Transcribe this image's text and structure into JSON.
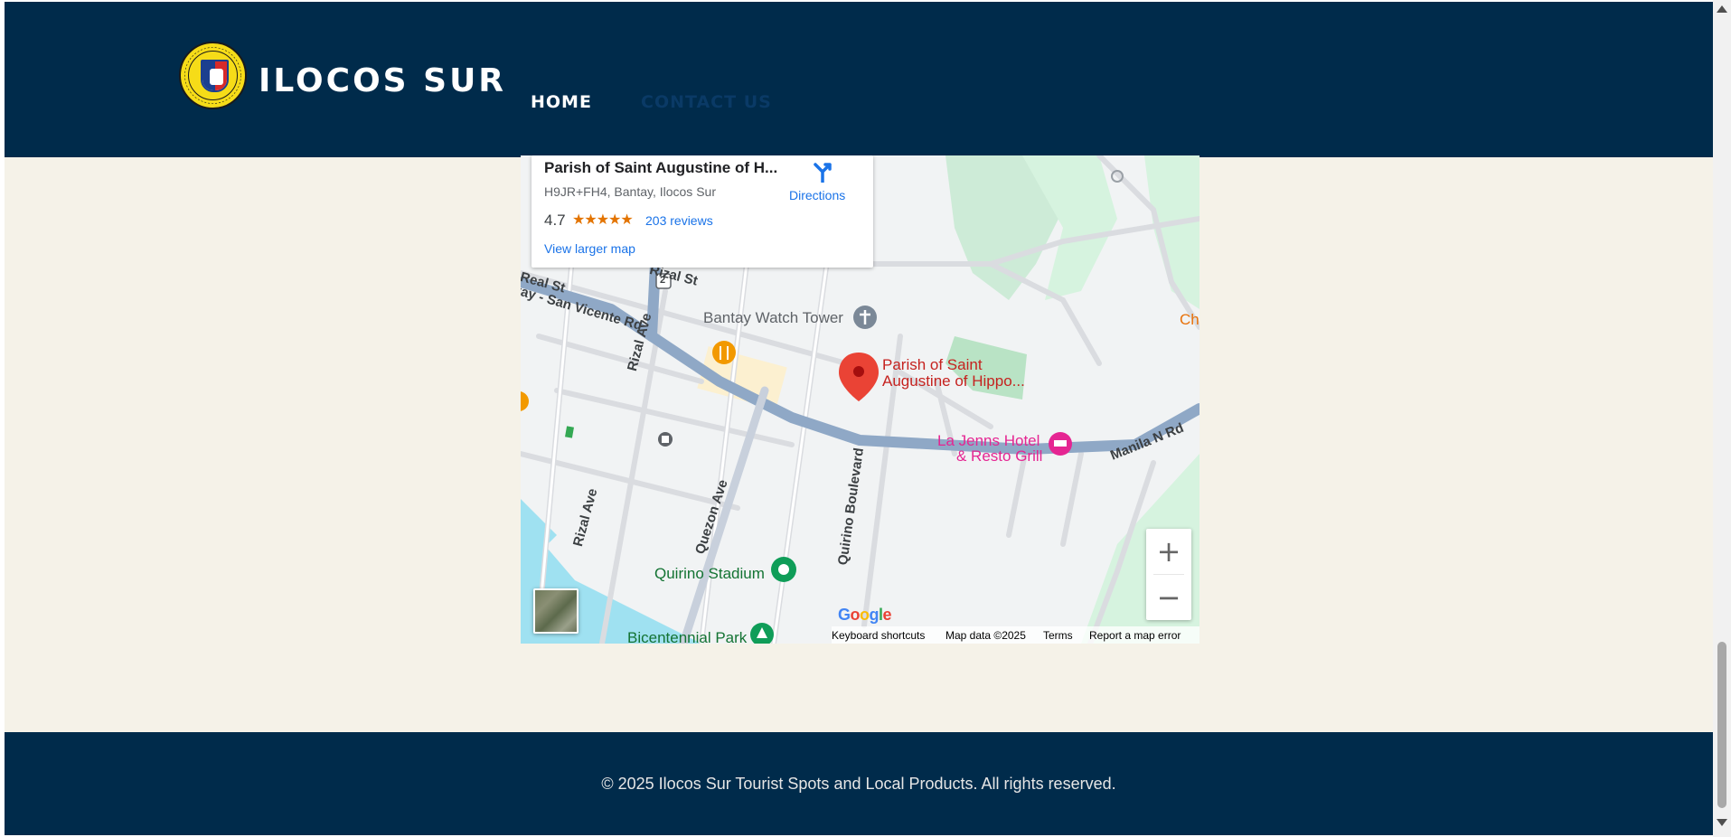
{
  "header": {
    "brand": "ILOCOS SUR",
    "seal_icon": "province-seal-icon",
    "nav": {
      "home": "HOME",
      "contact": "CONTACT US"
    },
    "colors": {
      "bar": "#002b4b",
      "active": "#ffffff",
      "inactive": "#0a3a66"
    }
  },
  "map": {
    "place": {
      "name": "Parish of Saint Augustine of H...",
      "address": "H9JR+FH4, Bantay, Ilocos Sur",
      "rating": "4.7",
      "stars": "★★★★★",
      "reviews": "203 reviews",
      "view_larger": "View larger map",
      "directions": "Directions"
    },
    "labels": {
      "watch_tower": "Bantay Watch Tower",
      "parish_line1": "Parish of Saint",
      "parish_line2": "Augustine of Hippo...",
      "hotel_line1": "La Jenns Hotel",
      "hotel_line2": "& Resto Grill",
      "stadium": "Quirino Stadium",
      "park": "Bicentennial Park",
      "rizal_ave_1": "Rizal Ave",
      "rizal_ave_2": "Rizal Ave",
      "quezon_ave": "Quezon Ave",
      "quirino_blvd": "Quirino Boulevard",
      "manila_rd": "Manila N Rd",
      "real_st": "Real St",
      "vicente_rd": "tay - San Vicente Rd",
      "zal_st": "Rizal St",
      "route_badge": "2",
      "edge_label": "Chi"
    },
    "zoom_in": "+",
    "zoom_out": "−",
    "google": "Google",
    "attribution": {
      "shortcuts": "Keyboard shortcuts",
      "data": "Map data ©2025",
      "terms": "Terms",
      "report": "Report a map error"
    }
  },
  "footer": {
    "copyright": "© 2025 Ilocos Sur Tourist Spots and Local Products. All rights reserved."
  }
}
